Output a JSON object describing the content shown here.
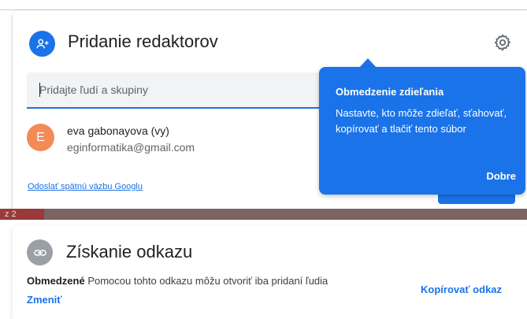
{
  "share": {
    "title": "Pridanie redaktorov",
    "input_placeholder": "Pridajte ľudí a skupiny",
    "user": {
      "initial": "E",
      "name": "eva gabonayova (vy)",
      "email": "eginformatika@gmail.com",
      "avatar_color": "#f28b55"
    },
    "feedback_link": "Odoslať spätnú väzbu Googlu"
  },
  "tooltip": {
    "title": "Obmedzenie zdieľania",
    "body": "Nastavte, kto môže zdieľať, sťahovať, kopírovať a tlačiť tento súbor",
    "ok_label": "Dobre"
  },
  "background": {
    "page_text": "z 2"
  },
  "link": {
    "title": "Získanie odkazu",
    "restriction_label": "Obmedzené",
    "description": "Pomocou tohto odkazu môžu otvoriť iba pridaní ľudia",
    "change_label": "Zmeniť",
    "copy_label": "Kopírovať odkaz"
  },
  "colors": {
    "accent": "#1a73e8",
    "link_icon_bg": "#9aa0a6"
  }
}
